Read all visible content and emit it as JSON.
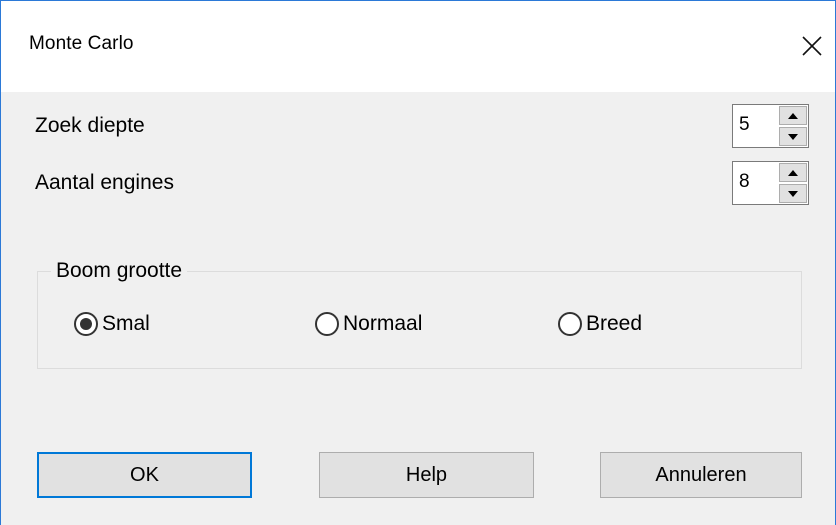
{
  "window": {
    "title": "Monte Carlo",
    "close_icon": "close-icon",
    "accent_color": "#0078d7"
  },
  "fields": {
    "search_depth": {
      "label": "Zoek diepte",
      "value": "5"
    },
    "engine_count": {
      "label": "Aantal engines",
      "value": "8"
    }
  },
  "tree_size": {
    "legend": "Boom grootte",
    "options": [
      {
        "label": "Smal",
        "selected": true
      },
      {
        "label": "Normaal",
        "selected": false
      },
      {
        "label": "Breed",
        "selected": false
      }
    ]
  },
  "buttons": {
    "ok": "OK",
    "help": "Help",
    "cancel": "Annuleren"
  }
}
